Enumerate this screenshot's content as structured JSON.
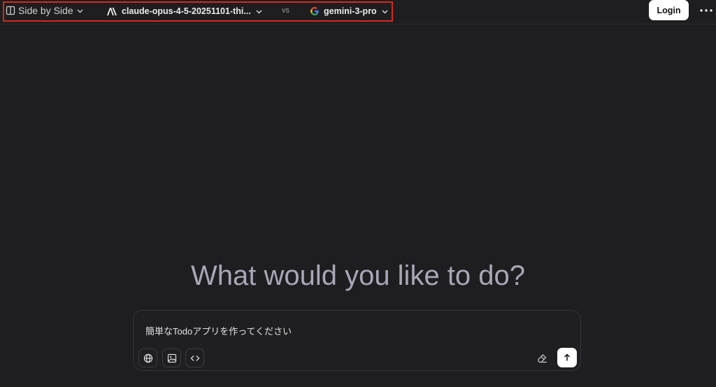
{
  "header": {
    "mode_label": "Side by Side",
    "model_a": {
      "name": "claude-opus-4-5-20251101-thi...",
      "icon": "anthropic-logo-icon"
    },
    "vs_label": "vs",
    "model_b": {
      "name": "gemini-3-pro",
      "icon": "google-logo-icon"
    },
    "login_label": "Login"
  },
  "main": {
    "headline": "What would you like to do?"
  },
  "composer": {
    "input_value": "簡単なTodoアプリを作ってください",
    "tools": [
      "globe-icon",
      "image-icon",
      "code-icon"
    ],
    "clear_icon": "eraser-icon",
    "send_icon": "arrow-up-icon"
  },
  "colors": {
    "background": "#1e1e20",
    "highlight_border": "#d42a1c",
    "headline": "#a9a6b6"
  }
}
